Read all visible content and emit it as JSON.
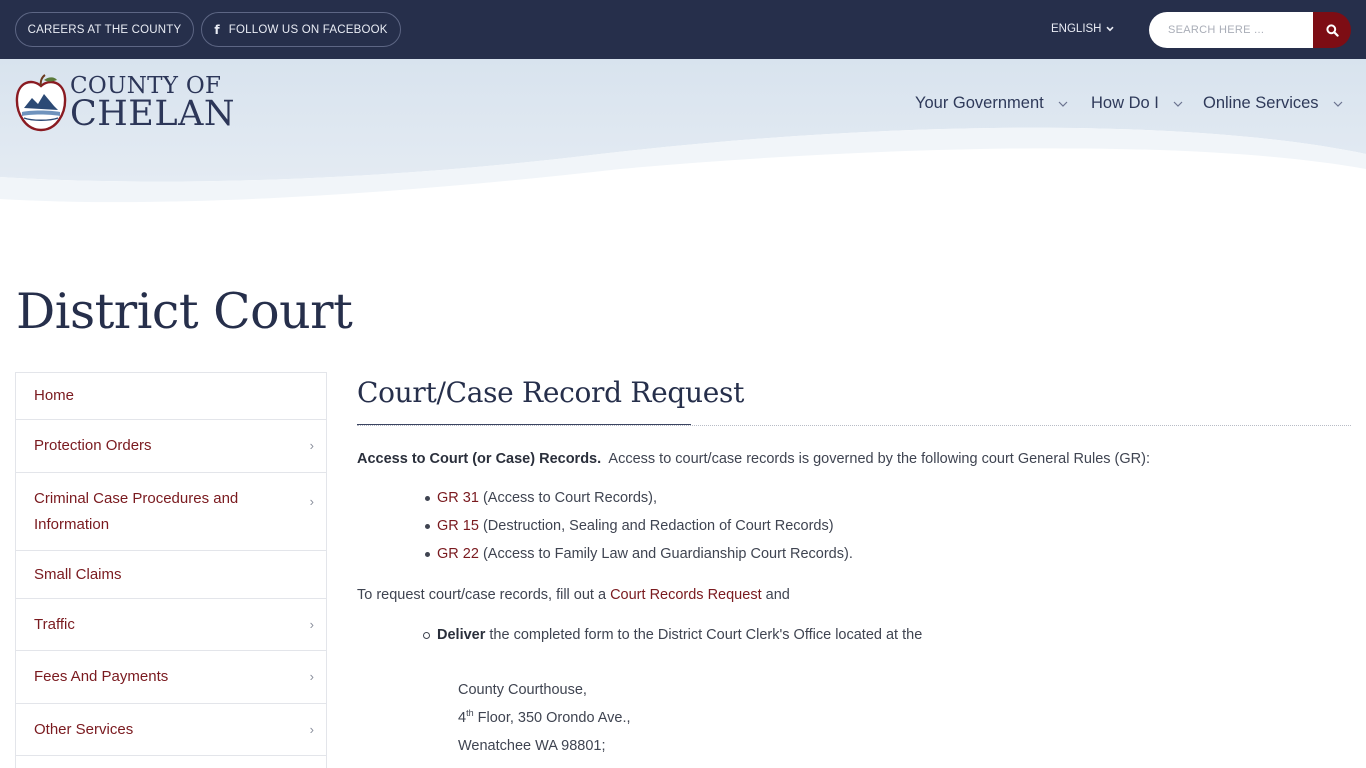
{
  "topbar": {
    "careers_label": "CAREERS AT THE COUNTY",
    "facebook_label": "FOLLOW US ON FACEBOOK",
    "facebook_icon": "f",
    "language": "ENGLISH",
    "search_placeholder": "SEARCH HERE ...",
    "search_icon": "search-icon"
  },
  "logo": {
    "line1": "COUNTY OF",
    "line2": "CHELAN"
  },
  "nav": [
    {
      "label": "Your Government"
    },
    {
      "label": "How Do I"
    },
    {
      "label": "Online Services"
    }
  ],
  "page_title": "District Court",
  "sidebar": {
    "items": [
      {
        "label": "Home",
        "has_submenu": false
      },
      {
        "label": "Protection Orders",
        "has_submenu": true
      },
      {
        "label": "Criminal Case Procedures and Information",
        "has_submenu": true
      },
      {
        "label": "Small Claims",
        "has_submenu": false
      },
      {
        "label": "Traffic",
        "has_submenu": true
      },
      {
        "label": "Fees And Payments",
        "has_submenu": true
      },
      {
        "label": "Other Services",
        "has_submenu": true
      }
    ]
  },
  "main": {
    "title": "Court/Case Record Request",
    "intro_bold": "Access to Court (or Case) Records.",
    "intro_text": "Access to court/case records is governed by the following court General Rules (GR):",
    "rules": [
      {
        "link": "GR 31",
        "text": "(Access to Court Records),"
      },
      {
        "link": "GR 15",
        "text": "(Destruction, Sealing and Redaction of Court Records)"
      },
      {
        "link": "GR 22",
        "text": "(Access to Family Law and Guardianship Court Records)."
      }
    ],
    "request_text": "To request court/case records, fill out a",
    "request_link": "Court Records Request",
    "request_and": "and",
    "deliver_bold": "Deliver",
    "deliver_text": "the completed form to the District Court Clerk's Office located at the",
    "address_line1": "County Courthouse,",
    "address_floor_num": "4",
    "address_floor_sup": "th",
    "address_floor_rest": "Floor, 350 Orondo Ave.,",
    "address_line3": "Wenatchee WA 98801;"
  },
  "colors": {
    "topbar_bg": "#262f4b",
    "accent_red": "#7d0d14",
    "link": "#7a1a1f",
    "header_bg": "#dde6f0"
  }
}
